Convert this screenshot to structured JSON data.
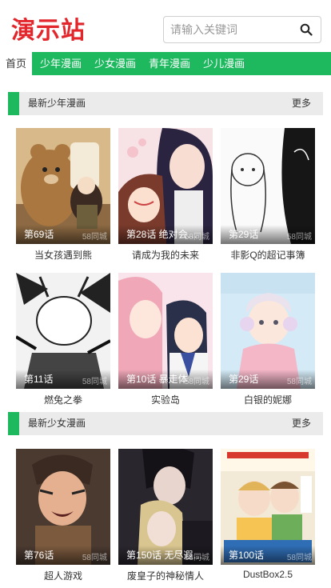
{
  "header": {
    "logo": "演示站",
    "search_placeholder": "请输入关键词"
  },
  "nav": [
    "首页",
    "少年漫画",
    "少女漫画",
    "青年漫画",
    "少儿漫画"
  ],
  "sections": [
    {
      "title": "最新少年漫画",
      "more": "更多",
      "items": [
        {
          "name": "当女孩遇到熊",
          "chapter": "第69话",
          "cover_color": "#c9a06a"
        },
        {
          "name": "请成为我的未来",
          "chapter": "第28话 绝对会…",
          "cover_color": "#f2c9cf"
        },
        {
          "name": "非影Q的超记事簿",
          "chapter": "第29话",
          "cover_color": "#f5f5f5"
        },
        {
          "name": "燃兔之拳",
          "chapter": "第11话",
          "cover_color": "#e8e8e8"
        },
        {
          "name": "实验岛",
          "chapter": "第10话 暴走体",
          "cover_color": "#f4d7e1"
        },
        {
          "name": "白银的妮娜",
          "chapter": "第29话",
          "cover_color": "#cfe6f5"
        }
      ]
    },
    {
      "title": "最新少女漫画",
      "more": "更多",
      "items": [
        {
          "name": "超人游戏",
          "chapter": "第76话",
          "cover_color": "#6b4a3a"
        },
        {
          "name": "废皇子的神秘情人",
          "chapter": "第150话 无尽遐…",
          "cover_color": "#2e2a33"
        },
        {
          "name": "DustBox2.5",
          "chapter": "第100话",
          "cover_color": "#e9dfc6"
        }
      ]
    }
  ],
  "watermark": "58同城"
}
